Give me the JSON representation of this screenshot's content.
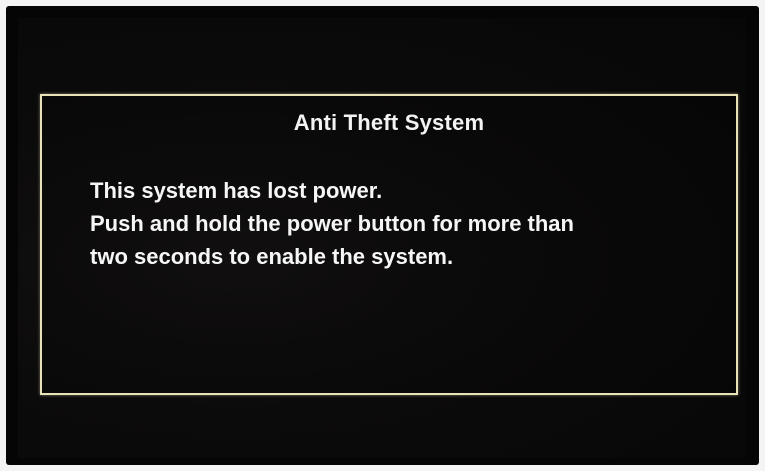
{
  "dialog": {
    "title": "Anti Theft System",
    "message_lines": [
      "This system has lost power.",
      "Push and hold the power button for more than",
      "two seconds to enable the system."
    ],
    "border_color": "#e8e2b8",
    "text_color": "#f3f3f3"
  },
  "screen": {
    "background_color": "#0b0a0a"
  }
}
